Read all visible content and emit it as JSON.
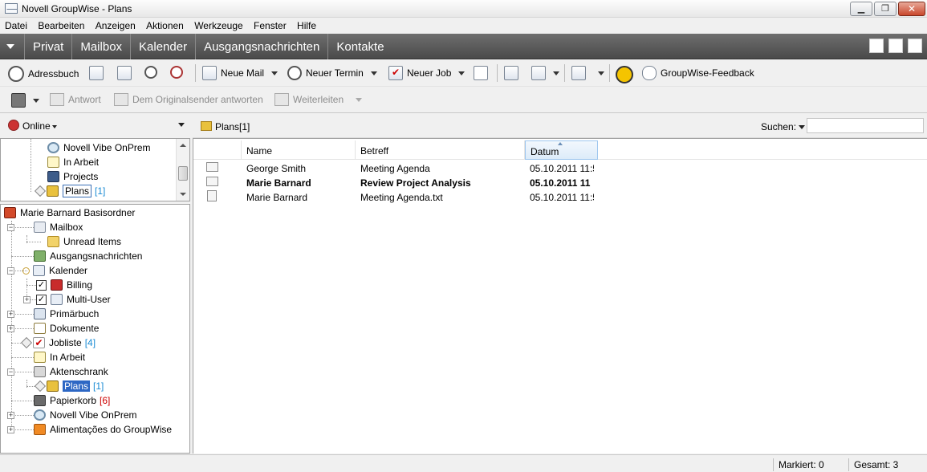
{
  "window": {
    "title": "Novell GroupWise - Plans"
  },
  "menu": [
    "Datei",
    "Bearbeiten",
    "Anzeigen",
    "Aktionen",
    "Werkzeuge",
    "Fenster",
    "Hilfe"
  ],
  "nav_tabs": [
    "Privat",
    "Mailbox",
    "Kalender",
    "Ausgangsnachrichten",
    "Kontakte"
  ],
  "toolbar1": {
    "adressbuch": "Adressbuch",
    "neue_mail": "Neue Mail",
    "neuer_termin": "Neuer Termin",
    "neuer_job": "Neuer Job",
    "feedback": "GroupWise-Feedback"
  },
  "toolbar2": {
    "antwort": "Antwort",
    "dem_originalsender": "Dem Originalsender antworten",
    "weiterleiten": "Weiterleiten"
  },
  "online": {
    "label": "Online"
  },
  "folder_header": {
    "name": "Plans",
    "count": "[1]",
    "search_label": "Suchen:"
  },
  "shortcuts": [
    {
      "label": "Novell Vibe OnPrem",
      "icon": "globe-icon"
    },
    {
      "label": "In Arbeit",
      "icon": "edit-icon"
    },
    {
      "label": "Projects",
      "icon": "projects-icon"
    },
    {
      "label": "Plans",
      "count": "[1]",
      "icon": "plans-icon"
    }
  ],
  "tree": {
    "root": "Marie Barnard Basisordner",
    "mailbox": "Mailbox",
    "unread_items": "Unread Items",
    "ausgangsnachrichten": "Ausgangsnachrichten",
    "kalender": "Kalender",
    "billing": "Billing",
    "multi_user": "Multi-User",
    "primarbuch": "Primärbuch",
    "dokumente": "Dokumente",
    "jobliste": "Jobliste",
    "jobliste_count": "[4]",
    "in_arbeit": "In Arbeit",
    "aktenschrank": "Aktenschrank",
    "plans": "Plans",
    "plans_count": "[1]",
    "papierkorb": "Papierkorb",
    "papierkorb_count": "[6]",
    "vibe": "Novell Vibe OnPrem",
    "alimentacoes": "Alimentações do GroupWise"
  },
  "list": {
    "columns": [
      "Name",
      "Betreff",
      "Datum"
    ],
    "rows": [
      {
        "name": "George Smith",
        "subject": "Meeting Agenda",
        "date": "05.10.2011 11:5",
        "unread": false,
        "icon": "mail-opened-icon"
      },
      {
        "name": "Marie Barnard",
        "subject": "Review Project Analysis",
        "date": "05.10.2011 11",
        "unread": true,
        "icon": "mail-attachment-icon"
      },
      {
        "name": "Marie Barnard",
        "subject": "Meeting Agenda.txt",
        "date": "05.10.2011 11:5",
        "unread": false,
        "icon": "document-icon"
      }
    ]
  },
  "status": {
    "markiert": "Markiert: 0",
    "gesamt": "Gesamt: 3"
  }
}
